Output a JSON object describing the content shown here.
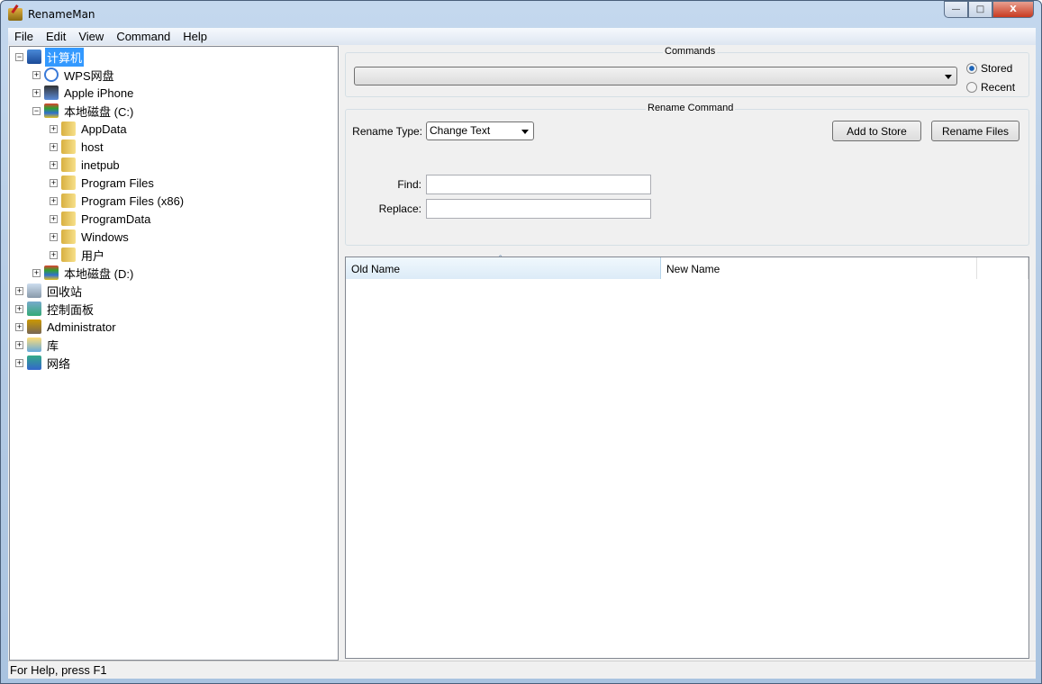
{
  "window": {
    "title": "RenameMan",
    "minimize": "—",
    "maximize": "□",
    "close": "X"
  },
  "menu": [
    "File",
    "Edit",
    "View",
    "Command",
    "Help"
  ],
  "tree": [
    {
      "label": "计算机",
      "level": 0,
      "expander": "−",
      "icon": "computer-icon",
      "selected": true
    },
    {
      "label": "WPS网盘",
      "level": 1,
      "expander": "+",
      "icon": "cloud-icon"
    },
    {
      "label": "Apple iPhone",
      "level": 1,
      "expander": "+",
      "icon": "phone-icon"
    },
    {
      "label": "本地磁盘 (C:)",
      "level": 1,
      "expander": "−",
      "icon": "drive-icon"
    },
    {
      "label": "AppData",
      "level": 2,
      "expander": "+",
      "icon": "folder-icon"
    },
    {
      "label": "host",
      "level": 2,
      "expander": "+",
      "icon": "folder-icon"
    },
    {
      "label": "inetpub",
      "level": 2,
      "expander": "+",
      "icon": "folder-icon"
    },
    {
      "label": "Program Files",
      "level": 2,
      "expander": "+",
      "icon": "folder-icon"
    },
    {
      "label": "Program Files (x86)",
      "level": 2,
      "expander": "+",
      "icon": "folder-icon"
    },
    {
      "label": "ProgramData",
      "level": 2,
      "expander": "+",
      "icon": "folder-icon"
    },
    {
      "label": "Windows",
      "level": 2,
      "expander": "+",
      "icon": "folder-icon"
    },
    {
      "label": "用户",
      "level": 2,
      "expander": "+",
      "icon": "folder-icon"
    },
    {
      "label": "本地磁盘 (D:)",
      "level": 1,
      "expander": "+",
      "icon": "drive-icon"
    },
    {
      "label": "回收站",
      "level": 0,
      "expander": "+",
      "icon": "recycle-bin-icon"
    },
    {
      "label": "控制面板",
      "level": 0,
      "expander": "+",
      "icon": "control-panel-icon"
    },
    {
      "label": "Administrator",
      "level": 0,
      "expander": "+",
      "icon": "user-icon"
    },
    {
      "label": "库",
      "level": 0,
      "expander": "+",
      "icon": "library-icon"
    },
    {
      "label": "网络",
      "level": 0,
      "expander": "+",
      "icon": "network-icon"
    }
  ],
  "commands": {
    "title": "Commands",
    "value": "",
    "stored": "Stored",
    "recent": "Recent",
    "selected": "Stored"
  },
  "rename": {
    "title": "Rename Command",
    "type_label": "Rename Type:",
    "type_value": "Change Text",
    "add_to_store": "Add to Store",
    "rename_files": "Rename Files",
    "find_label": "Find:",
    "find_value": "",
    "replace_label": "Replace:",
    "replace_value": ""
  },
  "list": {
    "columns": [
      "Old Name",
      "New Name"
    ],
    "sort_indicator": "ˆ",
    "rows": []
  },
  "status": "For Help, press F1"
}
